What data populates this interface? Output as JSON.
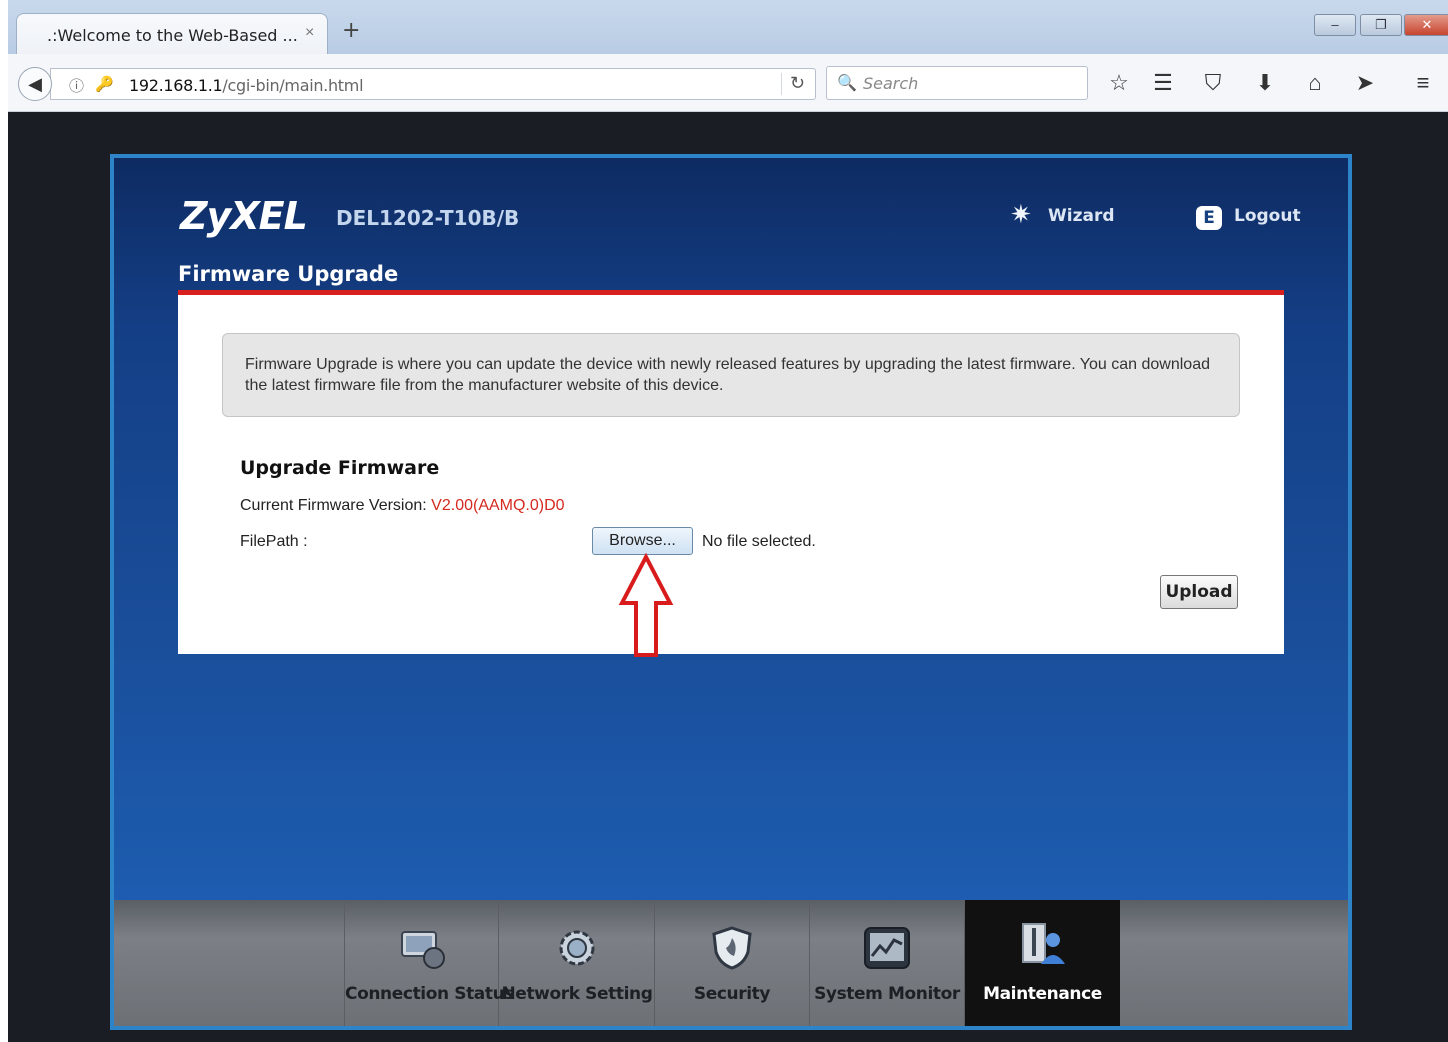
{
  "browser": {
    "tab_title": ".:Welcome to the Web-Based ...",
    "tab_close": "×",
    "new_tab": "+",
    "window_min": "‒",
    "window_restore": "❐",
    "window_close": "✕",
    "url_host": "192.168.1.1",
    "url_path": "/cgi-bin/main.html",
    "search_placeholder": "Search",
    "toolbar_icons": [
      "star-icon",
      "reading-list-icon",
      "pocket-icon",
      "download-icon",
      "home-icon",
      "send-icon",
      "menu-icon"
    ]
  },
  "router": {
    "logo": "ZyXEL",
    "model": "DEL1202-T10B/B",
    "wizard_label": "Wizard",
    "logout_label": "Logout",
    "logout_glyph": "E",
    "page_title": "Firmware Upgrade",
    "info_text": "Firmware Upgrade is where you can update the device with newly released features by upgrading the latest firmware. You can download the latest firmware file from the manufacturer website of this device.",
    "section_title": "Upgrade Firmware",
    "current_version_label": "Current Firmware Version: ",
    "current_version_value": "V2.00(AAMQ.0)D0",
    "filepath_label": "FilePath :",
    "browse_label": "Browse...",
    "no_file_text": "No file selected.",
    "upload_label": "Upload",
    "nav": [
      {
        "label": "Connection Status",
        "icon": "connection-status-icon"
      },
      {
        "label": "Network Setting",
        "icon": "network-setting-icon"
      },
      {
        "label": "Security",
        "icon": "security-shield-icon"
      },
      {
        "label": "System Monitor",
        "icon": "system-monitor-icon"
      },
      {
        "label": "Maintenance",
        "icon": "maintenance-icon",
        "active": true
      }
    ]
  },
  "colors": {
    "accent_red": "#d8201f",
    "version_red": "#d42a20",
    "router_border": "#2e84c8"
  }
}
